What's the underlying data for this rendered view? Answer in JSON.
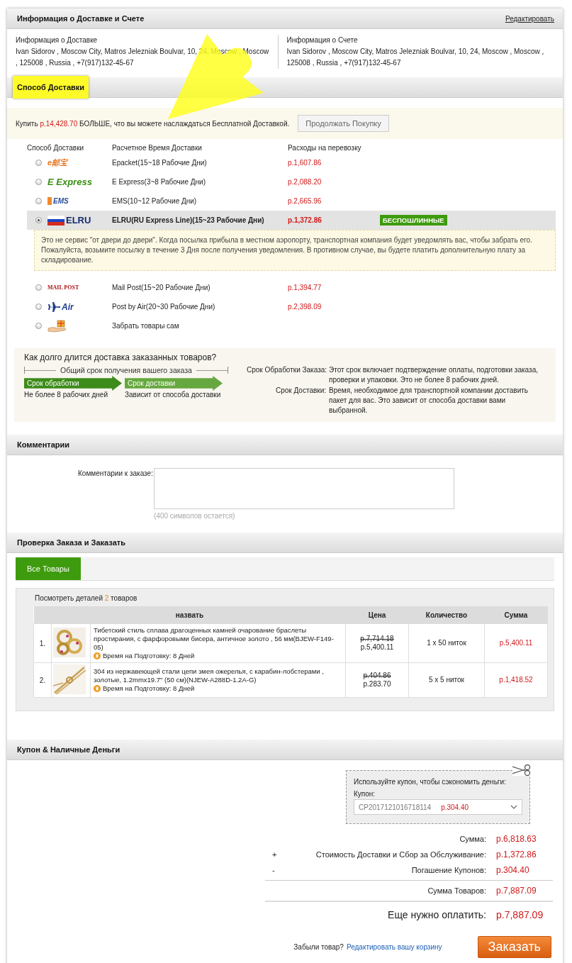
{
  "delivery_info": {
    "title": "Информация о Доставке и Счете",
    "edit_link": "Редактировать",
    "columns": [
      {
        "heading": "Информация о Доставке",
        "address": "Ivan   Sidorov ,  Moscow City, Matros Jelezniak Boulvar, 10, 24,  Moscow ,  Moscow , 125008 ,  Russia ,  +7(917)132-45-67"
      },
      {
        "heading": "Информация о Счете",
        "address": "Ivan   Sidorov ,  Moscow City, Matros Jelezniak Boulvar, 10, 24,  Moscow ,  Moscow ,  125008 ,  Russia ,  +7(917)132-45-67"
      }
    ]
  },
  "shipping": {
    "title": "Способ Доставки",
    "highlighted": true,
    "notice": {
      "before": "Купить",
      "amount": "р.14,428.70",
      "after": "БОЛЬШЕ, что вы можете наслаждаться Бесплатной Доставкой.",
      "button": "Продолжать Покупку"
    },
    "columns": [
      "Способ Доставки",
      "Расчетное Время Доставки",
      "Расходы на перевозку"
    ],
    "options": [
      {
        "logo": "e邮宝",
        "kind": "epacket",
        "name": "Epacket(15~18 Рабочие Дни)",
        "price": "р.1,607.86",
        "selected": false
      },
      {
        "logo": "E Express",
        "kind": "eexpress",
        "name": "E Express(3~8 Рабочие Дни)",
        "price": "р.2,088.20",
        "selected": false
      },
      {
        "logo": "EMS",
        "kind": "ems",
        "name": "EMS(10~12 Рабочие Дни)",
        "price": "р.2,665.96",
        "selected": false
      },
      {
        "logo": "ELRU",
        "kind": "elru",
        "name": "ELRU(RU Express Line)(15~23 Рабочие Дни)",
        "price": "р.1,372.86",
        "selected": true,
        "badge": "БЕСПОШЛИННЫЕ",
        "note": "Это не сервис \"от двери до двери\". Когда посылка прибыла в местном аэропорту, транспортная компания будет уведомлять вас, чтобы забрать его. Пожалуйста, возьмите посылку в течение 3 Дня после получения уведомления. В противном случае, вы будете платить дополнительную плату за складирование."
      },
      {
        "logo": "MAIL POST",
        "kind": "mailpost",
        "name": "Mail Post(15~20 Рабочие Дни)",
        "price": "р.1,394.77",
        "selected": false
      },
      {
        "logo": "Air",
        "kind": "air",
        "name": "Post by Air(20~30 Рабочие Дни)",
        "price": "р.2,398.09",
        "selected": false
      },
      {
        "kind": "pickup",
        "name": "Забрать товары сам",
        "selected": false
      }
    ]
  },
  "delivery_time": {
    "title": "Как долго длится доставка заказанных товаров?",
    "total": "Общий срок получения вашего заказа",
    "stages": [
      {
        "label": "Срок обработки",
        "caption": "Не более 8 рабочих дней",
        "color": "#3d8b1a"
      },
      {
        "label": "Срок доставки",
        "caption": "Зависит от способа доставки",
        "color": "#66a83f"
      }
    ],
    "definitions": [
      {
        "term": "Срок Обработки Заказа:",
        "text": "Этот срок включает подтверждение оплаты, подготовки заказа, проверки и упаковки. Это не более 8 рабочих дней."
      },
      {
        "term": "Срок Доставки:",
        "text": "Время, необходимое для транспортной компании доставить пакет для вас. Это зависит от способа доставки вами выбранной."
      }
    ]
  },
  "comments": {
    "title": "Комментарии",
    "label": "Комментарии к заказе:",
    "counter": "(400 символов остается)"
  },
  "review": {
    "title": "Проверка Заказа и Заказать",
    "tabs": [
      {
        "label": "Все Товары",
        "selected": true
      }
    ],
    "summary": {
      "before": "Посмотреть деталей",
      "count": "2",
      "after": "товаров"
    },
    "columns": [
      "назвать",
      "Цена",
      "Количество",
      "Сумма"
    ],
    "items": [
      {
        "index": "1.",
        "title": "Тибетский стиль сплава драгоценных камней очарование браслеты простирания, с фарфоровыми бисера, античное золото , 56 мм(BJEW-F149-05)",
        "prep": "Время на Подготовку: 8 Дней",
        "old_price": "р.7,714.18",
        "price": "р.5,400.11",
        "quantity": "1 x 50 ниток",
        "total": "р.5,400.11"
      },
      {
        "index": "2.",
        "title": "304 из нержавеющей стали цепи змея ожерелья, с карабин-лобстерами , золотые, 1.2mmx19.7\" (50 см)(NJEW-A288D-1.2A-G)",
        "prep": "Время на Подготовку: 8 Дней",
        "old_price": "р.404.86",
        "price": "р.283.70",
        "quantity": "5 x 5 ниток",
        "total": "р.1,418.52"
      }
    ]
  },
  "coupon": {
    "title": "Купон & Наличные Деньги",
    "prompt": "Используйте купон, чтобы сэкономить деньги:",
    "label": "Купон:",
    "code": "CP2017121016718114",
    "amount": "р.304.40"
  },
  "totals": [
    {
      "label": "Сумма:",
      "value": "р.6,818.63"
    },
    {
      "sign": "+",
      "label": "Стоимость Доставки и Сбор за Обслуживание:",
      "value": "р.1,372.86"
    },
    {
      "sign": "-",
      "label": "Погашение Купонов:",
      "value": "р.304.40"
    },
    {
      "label": "Сумма Товаров:",
      "value": "р.7,887.09",
      "rule_before": true
    }
  ],
  "due": {
    "label": "Еще нужно оплатить:",
    "value": "р.7,887.09"
  },
  "footer": {
    "question": "Забыли товар?",
    "link": "Редактировать вашу корзину",
    "button": "Заказать"
  }
}
